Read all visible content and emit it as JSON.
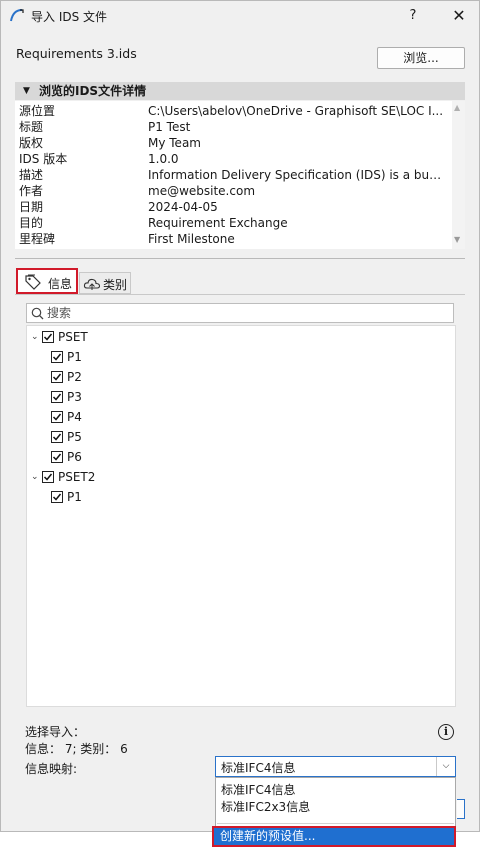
{
  "window": {
    "title": "导入 IDS 文件",
    "help_label": "?",
    "close_label": "✕"
  },
  "file": {
    "name": "Requirements 3.ids",
    "browse_label": "浏览..."
  },
  "details": {
    "header": "浏览的IDS文件详情",
    "rows": [
      {
        "label": "源位置",
        "value": "C:\\Users\\abelov\\OneDrive - Graphisoft SE\\LOC I..."
      },
      {
        "label": "标题",
        "value": "P1 Test"
      },
      {
        "label": "版权",
        "value": "My Team"
      },
      {
        "label": "IDS 版本",
        "value": "1.0.0"
      },
      {
        "label": "描述",
        "value": "Information Delivery Specification (IDS) is a buildi..."
      },
      {
        "label": "作者",
        "value": "me@website.com"
      },
      {
        "label": "日期",
        "value": "2024-04-05"
      },
      {
        "label": "目的",
        "value": "Requirement Exchange"
      },
      {
        "label": "里程碑",
        "value": "First Milestone"
      }
    ]
  },
  "tabs": {
    "info": "信息",
    "category": "类别"
  },
  "search": {
    "placeholder": "搜索"
  },
  "tree": {
    "groups": [
      {
        "name": "PSET",
        "items": [
          "P1",
          "P2",
          "P3",
          "P4",
          "P5",
          "P6"
        ]
      },
      {
        "name": "PSET2",
        "items": [
          "P1"
        ]
      }
    ]
  },
  "bottom": {
    "select_import_label": "选择导入：",
    "summary": "信息： 7; 类别： 6",
    "mapping_label": "信息映射:",
    "mapping_value": "标准IFC4信息",
    "options": [
      "标准IFC4信息",
      "标准IFC2x3信息"
    ],
    "create_new": "创建新的预设值..."
  },
  "colors": {
    "highlight_border": "#d11a2a",
    "selection": "#1f6fd0",
    "focus": "#2a72c9"
  },
  "icons": {
    "app": "arc-icon",
    "info_tab": "tag-icon",
    "category_tab": "cloud-icon",
    "search": "search-icon",
    "help": "info-circle-icon"
  }
}
